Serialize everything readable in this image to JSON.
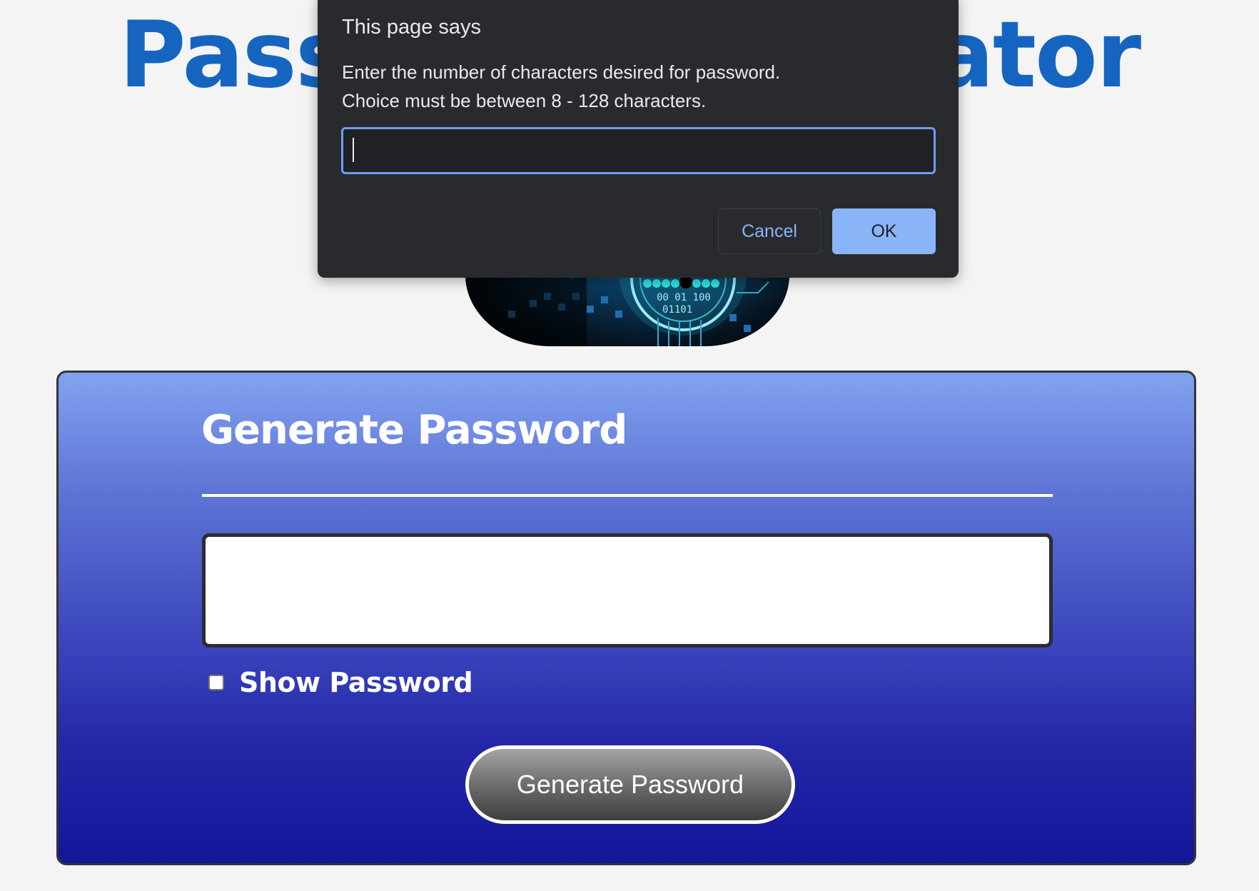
{
  "page": {
    "title": "Password Generator"
  },
  "card": {
    "title": "Generate Password",
    "password_value": "",
    "show_password_label": "Show Password",
    "show_password_checked": false,
    "generate_button_label": "Generate Password"
  },
  "dialog": {
    "title": "This page says",
    "message_line1": "Enter the number of characters desired for password.",
    "message_line2": "Choice must be between 8 - 128 characters.",
    "input_value": "",
    "cancel_label": "Cancel",
    "ok_label": "OK"
  },
  "colors": {
    "title_blue": "#1565c0",
    "dialog_bg": "#292a2d",
    "dialog_accent": "#8ab4f8",
    "card_top": "#81a2f0",
    "card_bottom": "#141699"
  },
  "icons": {
    "hero": "lock-circuit-image"
  }
}
